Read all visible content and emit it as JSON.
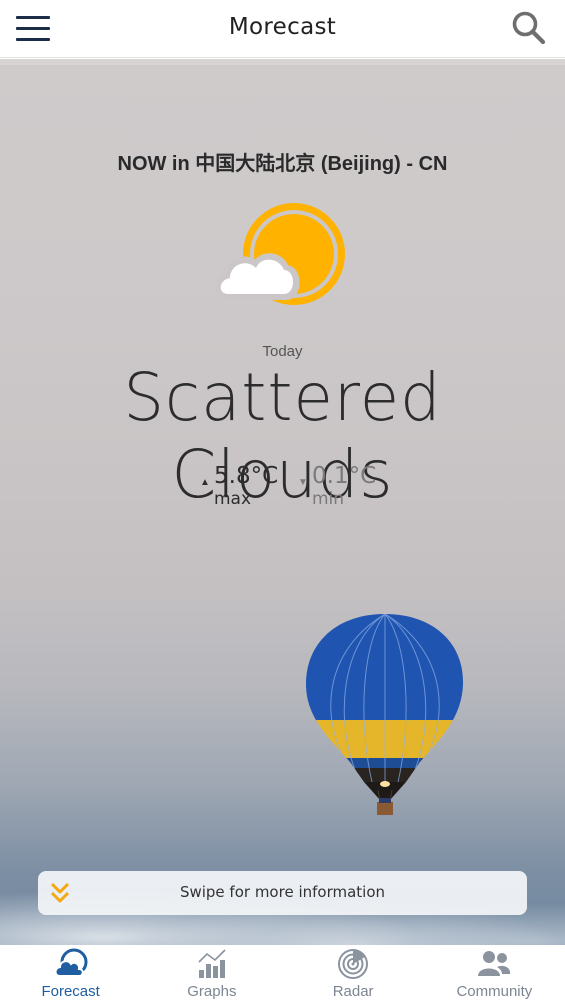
{
  "header": {
    "title": "Morecast",
    "menu_icon": "hamburger-menu-icon",
    "search_icon": "search-icon"
  },
  "current": {
    "location_label": "NOW in 中国大陆北京 (Beijing) - CN",
    "weather_icon": "sun-behind-cloud-icon",
    "day_label": "Today",
    "condition": "Scattered Clouds",
    "max": {
      "value": "5.8°C",
      "label": "max",
      "icon": "triangle-up-icon"
    },
    "min": {
      "value": "0.1°C",
      "label": "min",
      "icon": "triangle-down-icon"
    }
  },
  "swipe_hint": {
    "text": "Swipe for more information",
    "icon": "double-chevron-down-icon"
  },
  "bottom_nav": {
    "active": "Forecast",
    "items": [
      {
        "label": "Forecast",
        "icon": "forecast-cloud-icon"
      },
      {
        "label": "Graphs",
        "icon": "graphs-chart-icon"
      },
      {
        "label": "Radar",
        "icon": "radar-icon"
      },
      {
        "label": "Community",
        "icon": "community-people-icon"
      }
    ]
  },
  "colors": {
    "accent_blue": "#1f5ea0",
    "sun_yellow": "#ffb300",
    "nav_inactive": "#7c8693",
    "header_navy": "#1b2d48"
  }
}
